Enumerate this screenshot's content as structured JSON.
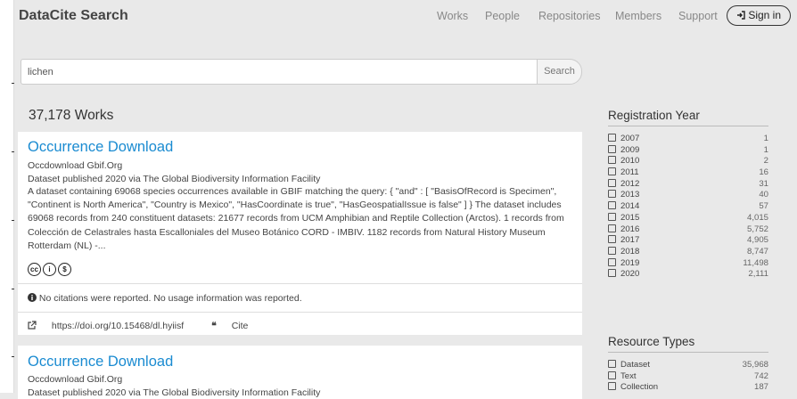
{
  "navbar": {
    "brand": "DataCite Search",
    "links": [
      "Works",
      "People",
      "Repositories",
      "Members",
      "Support"
    ],
    "signin_icon": "sign-in-icon",
    "signin_label": "Sign in"
  },
  "search": {
    "value": "lichen",
    "button_label": "Search"
  },
  "results_count": "37,178 Works",
  "results": [
    {
      "title": "Occurrence Download",
      "publisher": "Occdownload Gbif.Org",
      "published": "Dataset published 2020 via The Global Biodiversity Information Facility",
      "description": "A dataset containing 69068 species occurrences available in GBIF matching the query: { \"and\" : [ \"BasisOfRecord is Specimen\", \"Continent is North America\", \"Country is Mexico\", \"HasCoordinate is true\", \"HasGeospatialIssue is false\" ] } The dataset includes 69068 records from 240 constituent datasets: 21677 records from UCM Amphibian and Reptile Collection (Arctos). 1 records from Colección de Celastrales hasta Escalloniales del Museo Botánico CORD - IMBIV. 1182 records from Natural History Museum Rotterdam (NL) -...",
      "license_icons": [
        "cc-icon",
        "by-icon",
        "nc-icon"
      ],
      "info": "No citations were reported. No usage information was reported.",
      "doi": "https://doi.org/10.15468/dl.hyiisf",
      "cite_label": "Cite"
    },
    {
      "title": "Occurrence Download",
      "publisher": "Occdownload Gbif.Org",
      "published": "Dataset published 2020 via The Global Biodiversity Information Facility"
    }
  ],
  "facets": {
    "registration_year": {
      "title": "Registration Year",
      "items": [
        {
          "label": "2007",
          "count": "1"
        },
        {
          "label": "2009",
          "count": "1"
        },
        {
          "label": "2010",
          "count": "2"
        },
        {
          "label": "2011",
          "count": "16"
        },
        {
          "label": "2012",
          "count": "31"
        },
        {
          "label": "2013",
          "count": "40"
        },
        {
          "label": "2014",
          "count": "57"
        },
        {
          "label": "2015",
          "count": "4,015"
        },
        {
          "label": "2016",
          "count": "5,752"
        },
        {
          "label": "2017",
          "count": "4,905"
        },
        {
          "label": "2018",
          "count": "8,747"
        },
        {
          "label": "2019",
          "count": "11,498"
        },
        {
          "label": "2020",
          "count": "2,111"
        }
      ]
    },
    "resource_types": {
      "title": "Resource Types",
      "items": [
        {
          "label": "Dataset",
          "count": "35,968"
        },
        {
          "label": "Text",
          "count": "742"
        },
        {
          "label": "Collection",
          "count": "187"
        }
      ]
    }
  }
}
